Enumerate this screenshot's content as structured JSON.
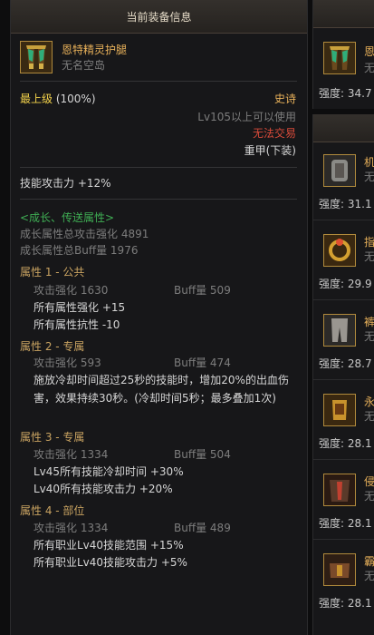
{
  "panel": {
    "header": "当前装备信息",
    "item_name": "恩特精灵护腿",
    "item_origin": "无名空岛",
    "grade_label": "最上级",
    "grade_percent": "(100%)",
    "rarity": "史诗",
    "level_req": "Lv105以上可以使用",
    "trade": "无法交易",
    "armor_type": "重甲(下装)",
    "skill_atk": "技能攻击力 +12%",
    "growth": {
      "title": "<成长、传送属性>",
      "total_atk": "成长属性总攻击强化 4891",
      "total_buff": "成长属性总Buff量 1976"
    },
    "attributes": [
      {
        "title": "属性 1 - 公共",
        "atk": "攻击强化 1630",
        "buff": "Buff量 509",
        "lines": [
          "所有属性强化 +15",
          "所有属性抗性 -10"
        ]
      },
      {
        "title": "属性 2 - 专属",
        "atk": "攻击强化 593",
        "buff": "Buff量 474",
        "lines": [
          "施放冷却时间超过25秒的技能时，增加20%的出血伤害，效果持续30秒。(冷却时间5秒；最多叠加1次)"
        ]
      },
      {
        "title": "属性 3 - 专属",
        "atk": "攻击强化 1334",
        "buff": "Buff量 504",
        "lines": [
          "Lv45所有技能冷却时间 +30%",
          "Lv40所有技能攻击力 +20%"
        ]
      },
      {
        "title": "属性 4 - 部位",
        "atk": "攻击强化 1334",
        "buff": "Buff量 489",
        "lines": [
          "所有职业Lv40技能范围 +15%",
          "所有职业Lv40技能攻击力 +5%"
        ]
      }
    ]
  },
  "side": {
    "top_item": {
      "name": "恩",
      "sub": "无",
      "stat": "强度: 34.7"
    },
    "items": [
      {
        "name": "机",
        "sub": "无",
        "stat": "强度: 31.1"
      },
      {
        "name": "指",
        "sub": "无",
        "stat": "强度: 29.9"
      },
      {
        "name": "裤",
        "sub": "无",
        "stat": "强度: 28.7"
      },
      {
        "name": "永",
        "sub": "无",
        "stat": "强度: 28.1"
      },
      {
        "name": "侵",
        "sub": "无",
        "stat": "强度: 28.1"
      },
      {
        "name": "霸",
        "sub": "无",
        "stat": "强度: 28.1"
      }
    ]
  }
}
